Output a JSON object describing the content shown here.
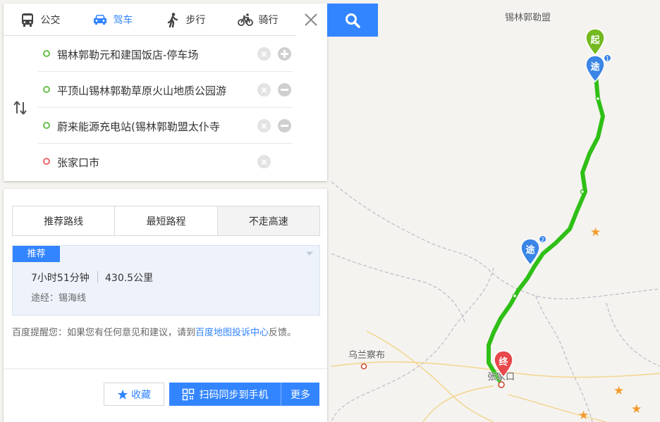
{
  "modes": [
    {
      "label": "公交",
      "icon": "bus-icon"
    },
    {
      "label": "驾车",
      "icon": "car-icon"
    },
    {
      "label": "步行",
      "icon": "walk-icon"
    },
    {
      "label": "骑行",
      "icon": "bike-icon"
    }
  ],
  "active_mode": "驾车",
  "stops": [
    {
      "text": "锡林郭勒元和建国饭店-停车场",
      "action": "add"
    },
    {
      "text": "平顶山锡林郭勒草原火山地质公园游",
      "action": "remove"
    },
    {
      "text": "蔚来能源充电站(锡林郭勒盟太仆寺",
      "action": "remove"
    },
    {
      "text": "张家口市",
      "action": "none"
    }
  ],
  "route_tabs": [
    "推荐路线",
    "最短路程",
    "不走高速"
  ],
  "plan": {
    "badge": "推荐",
    "time": "7小时51分钟",
    "distance": "430.5公里",
    "via": "途经：锡海线"
  },
  "notice": {
    "prefix": "百度提醒您：如果您有任何意见和建议，请到",
    "link": "百度地图投诉中心",
    "suffix": "反馈。"
  },
  "buttons": {
    "favorite": "收藏",
    "sync": "扫码同步到手机",
    "more": "更多"
  },
  "map": {
    "labels": {
      "region_top": "锡林郭勒盟",
      "city_left": "乌兰察布",
      "city_end": "张家口"
    },
    "markers": {
      "start": "起",
      "via": "途",
      "end": "终",
      "via1_num": "1",
      "via2_num": "2"
    },
    "route_color": "#2fbf16",
    "start_color": "#74b91f",
    "via_color": "#3a85e6",
    "end_color": "#e8474b"
  }
}
